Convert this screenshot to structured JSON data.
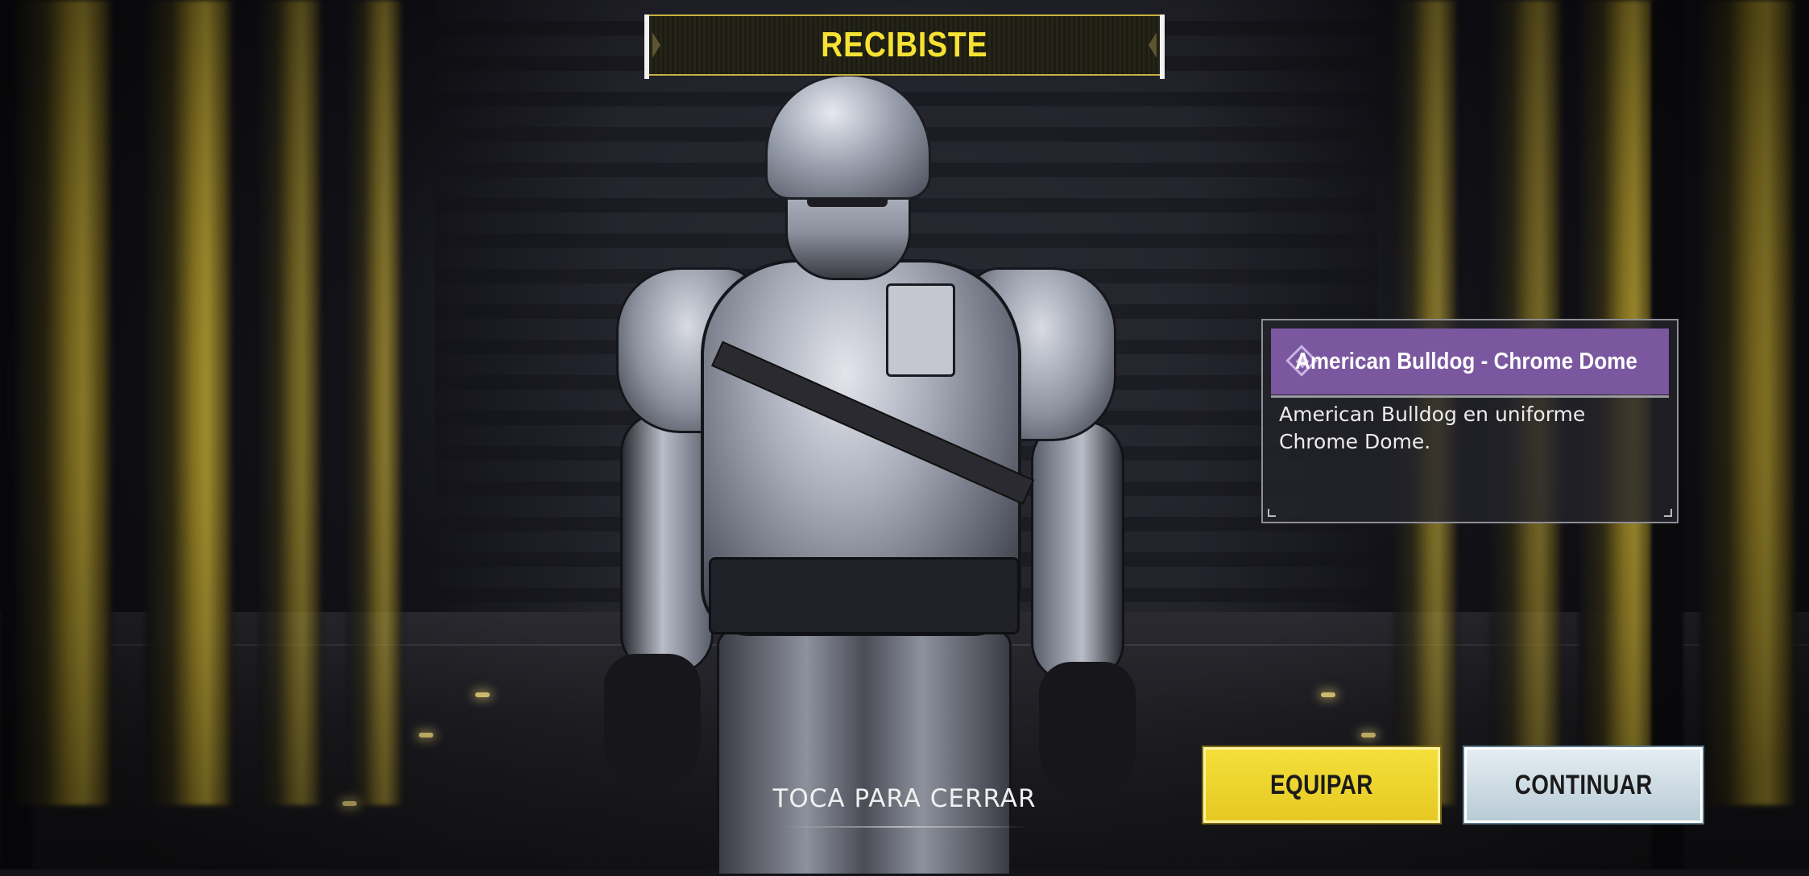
{
  "screen": {
    "banner_title": "RECIBISTE",
    "tap_to_close": "TOCA PARA CERRAR"
  },
  "item": {
    "name": "American Bulldog - Chrome Dome",
    "description": "American Bulldog en uniforme Chrome Dome.",
    "rarity_icon": "epic-diamond-icon",
    "rarity_color": "#7a579f"
  },
  "actions": {
    "equip_label": "EQUIPAR",
    "continue_label": "CONTINUAR"
  },
  "colors": {
    "banner_text": "#f6e233",
    "equip_button": "#f4df3a",
    "continue_button": "#d4e2ea"
  }
}
